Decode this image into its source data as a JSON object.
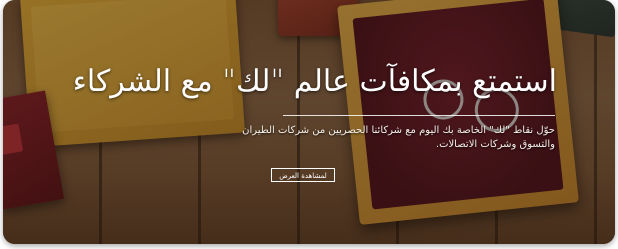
{
  "banner": {
    "headline": "استمتع بمكافآت عالم \"لك\" مع الشركاء",
    "subtext": "حوّل نقاط \"لك\" الخاصة بك اليوم مع شركائنا الحصريين من شركات الطيران والتسوق وشركات الاتصالات.",
    "cta_label": "لمشاهدة العرض"
  },
  "colors": {
    "overlay": "#231409",
    "text": "#ffffff"
  }
}
